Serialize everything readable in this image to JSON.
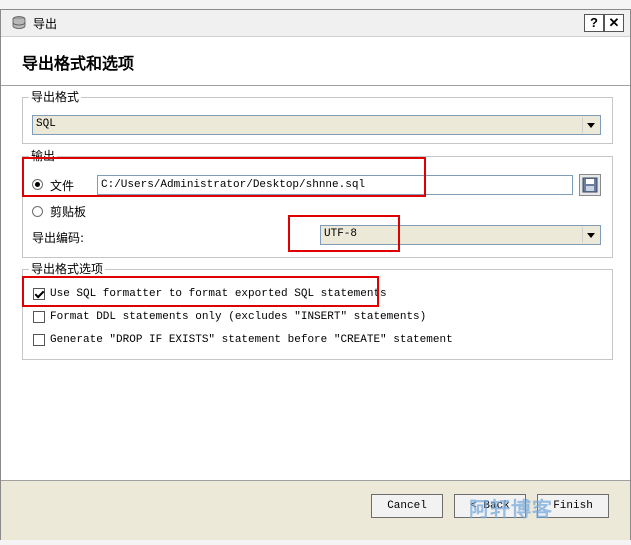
{
  "window": {
    "title": "导出",
    "help_label": "?",
    "close_label": "✕"
  },
  "header": {
    "title": "导出格式和选项"
  },
  "export_format": {
    "legend": "导出格式",
    "selected": "SQL"
  },
  "output": {
    "legend": "输出",
    "file_label": "文件",
    "file_path": "C:/Users/Administrator/Desktop/shnne.sql",
    "clipboard_label": "剪贴板",
    "encoding_label": "导出编码:",
    "encoding_value": "UTF-8",
    "file_selected": true
  },
  "options": {
    "legend": "导出格式选项",
    "items": [
      {
        "label": "Use SQL formatter to format exported SQL statements",
        "checked": true
      },
      {
        "label": "Format DDL statements only (excludes \"INSERT\" statements)",
        "checked": false
      },
      {
        "label": "Generate \"DROP IF EXISTS\" statement before \"CREATE\" statement",
        "checked": false
      }
    ]
  },
  "buttons": {
    "cancel": "Cancel",
    "back": "< Back",
    "finish": "Finish"
  },
  "watermark": "阿轩博客",
  "colors": {
    "highlight": "#e00000",
    "watermark": "#78aadc"
  }
}
